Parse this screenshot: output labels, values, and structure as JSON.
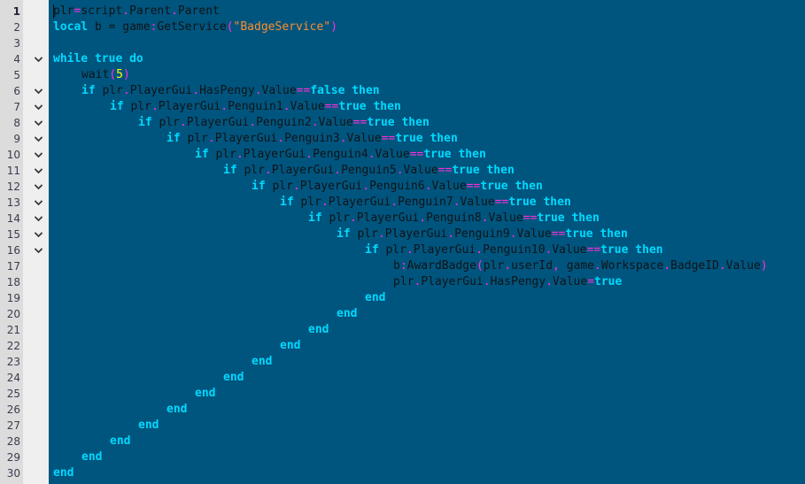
{
  "editor": {
    "title": "Lua Script Editor",
    "language": "Lua",
    "background_color": "#00557e",
    "gutter_number_color": "#3b3b4f",
    "gutter_background": "#dcdcdc",
    "fold_column_background": "#efefef",
    "colors": {
      "keyword": "#00d9ff",
      "operator": "#ff2fd8",
      "number": "#ffff00",
      "string": "#ff8c2b",
      "plain": "#101418"
    },
    "total_lines": 30,
    "line_numbers": [
      "1",
      "2",
      "3",
      "4",
      "5",
      "6",
      "7",
      "8",
      "9",
      "10",
      "11",
      "12",
      "13",
      "14",
      "15",
      "16",
      "17",
      "18",
      "19",
      "20",
      "21",
      "22",
      "23",
      "24",
      "25",
      "26",
      "27",
      "28",
      "29",
      "30"
    ],
    "fold_markers": [
      4,
      6,
      7,
      8,
      9,
      10,
      11,
      12,
      13,
      14,
      15,
      16
    ],
    "fold_icon": "chevron-down-icon",
    "caret_line": 1,
    "caret_column": 0,
    "lines": [
      {
        "n": 1,
        "indent": 0,
        "tokens": [
          {
            "t": "plr",
            "c": "plain"
          },
          {
            "t": "=",
            "c": "op"
          },
          {
            "t": "script",
            "c": "plain"
          },
          {
            "t": ".",
            "c": "op"
          },
          {
            "t": "Parent",
            "c": "plain"
          },
          {
            "t": ".",
            "c": "op"
          },
          {
            "t": "Parent",
            "c": "plain"
          }
        ]
      },
      {
        "n": 2,
        "indent": 0,
        "tokens": [
          {
            "t": "local",
            "c": "kw"
          },
          {
            "t": " b = game",
            "c": "plain"
          },
          {
            "t": ":",
            "c": "op"
          },
          {
            "t": "GetService",
            "c": "plain"
          },
          {
            "t": "(",
            "c": "op"
          },
          {
            "t": "\"BadgeService\"",
            "c": "str"
          },
          {
            "t": ")",
            "c": "op"
          }
        ]
      },
      {
        "n": 3,
        "indent": 0,
        "tokens": []
      },
      {
        "n": 4,
        "indent": 0,
        "tokens": [
          {
            "t": "while true do",
            "c": "kw"
          }
        ]
      },
      {
        "n": 5,
        "indent": 4,
        "tokens": [
          {
            "t": "wait",
            "c": "plain"
          },
          {
            "t": "(",
            "c": "op"
          },
          {
            "t": "5",
            "c": "num"
          },
          {
            "t": ")",
            "c": "op"
          }
        ]
      },
      {
        "n": 6,
        "indent": 4,
        "tokens": [
          {
            "t": "if",
            "c": "kw"
          },
          {
            "t": " plr",
            "c": "plain"
          },
          {
            "t": ".",
            "c": "op"
          },
          {
            "t": "PlayerGui",
            "c": "plain"
          },
          {
            "t": ".",
            "c": "op"
          },
          {
            "t": "HasPengy",
            "c": "plain"
          },
          {
            "t": ".",
            "c": "op"
          },
          {
            "t": "Value",
            "c": "plain"
          },
          {
            "t": "==",
            "c": "op"
          },
          {
            "t": "false then",
            "c": "kw"
          }
        ]
      },
      {
        "n": 7,
        "indent": 8,
        "tokens": [
          {
            "t": "if",
            "c": "kw"
          },
          {
            "t": " plr",
            "c": "plain"
          },
          {
            "t": ".",
            "c": "op"
          },
          {
            "t": "PlayerGui",
            "c": "plain"
          },
          {
            "t": ".",
            "c": "op"
          },
          {
            "t": "Penguin1",
            "c": "plain"
          },
          {
            "t": ".",
            "c": "op"
          },
          {
            "t": "Value",
            "c": "plain"
          },
          {
            "t": "==",
            "c": "op"
          },
          {
            "t": "true then",
            "c": "kw"
          }
        ]
      },
      {
        "n": 8,
        "indent": 12,
        "tokens": [
          {
            "t": "if",
            "c": "kw"
          },
          {
            "t": " plr",
            "c": "plain"
          },
          {
            "t": ".",
            "c": "op"
          },
          {
            "t": "PlayerGui",
            "c": "plain"
          },
          {
            "t": ".",
            "c": "op"
          },
          {
            "t": "Penguin2",
            "c": "plain"
          },
          {
            "t": ".",
            "c": "op"
          },
          {
            "t": "Value",
            "c": "plain"
          },
          {
            "t": "==",
            "c": "op"
          },
          {
            "t": "true then",
            "c": "kw"
          }
        ]
      },
      {
        "n": 9,
        "indent": 16,
        "tokens": [
          {
            "t": "if",
            "c": "kw"
          },
          {
            "t": " plr",
            "c": "plain"
          },
          {
            "t": ".",
            "c": "op"
          },
          {
            "t": "PlayerGui",
            "c": "plain"
          },
          {
            "t": ".",
            "c": "op"
          },
          {
            "t": "Penguin3",
            "c": "plain"
          },
          {
            "t": ".",
            "c": "op"
          },
          {
            "t": "Value",
            "c": "plain"
          },
          {
            "t": "==",
            "c": "op"
          },
          {
            "t": "true then",
            "c": "kw"
          }
        ]
      },
      {
        "n": 10,
        "indent": 20,
        "tokens": [
          {
            "t": "if",
            "c": "kw"
          },
          {
            "t": " plr",
            "c": "plain"
          },
          {
            "t": ".",
            "c": "op"
          },
          {
            "t": "PlayerGui",
            "c": "plain"
          },
          {
            "t": ".",
            "c": "op"
          },
          {
            "t": "Penguin4",
            "c": "plain"
          },
          {
            "t": ".",
            "c": "op"
          },
          {
            "t": "Value",
            "c": "plain"
          },
          {
            "t": "==",
            "c": "op"
          },
          {
            "t": "true then",
            "c": "kw"
          }
        ]
      },
      {
        "n": 11,
        "indent": 24,
        "tokens": [
          {
            "t": "if",
            "c": "kw"
          },
          {
            "t": " plr",
            "c": "plain"
          },
          {
            "t": ".",
            "c": "op"
          },
          {
            "t": "PlayerGui",
            "c": "plain"
          },
          {
            "t": ".",
            "c": "op"
          },
          {
            "t": "Penguin5",
            "c": "plain"
          },
          {
            "t": ".",
            "c": "op"
          },
          {
            "t": "Value",
            "c": "plain"
          },
          {
            "t": "==",
            "c": "op"
          },
          {
            "t": "true then",
            "c": "kw"
          }
        ]
      },
      {
        "n": 12,
        "indent": 28,
        "tokens": [
          {
            "t": "if",
            "c": "kw"
          },
          {
            "t": " plr",
            "c": "plain"
          },
          {
            "t": ".",
            "c": "op"
          },
          {
            "t": "PlayerGui",
            "c": "plain"
          },
          {
            "t": ".",
            "c": "op"
          },
          {
            "t": "Penguin6",
            "c": "plain"
          },
          {
            "t": ".",
            "c": "op"
          },
          {
            "t": "Value",
            "c": "plain"
          },
          {
            "t": "==",
            "c": "op"
          },
          {
            "t": "true then",
            "c": "kw"
          }
        ]
      },
      {
        "n": 13,
        "indent": 32,
        "tokens": [
          {
            "t": "if",
            "c": "kw"
          },
          {
            "t": " plr",
            "c": "plain"
          },
          {
            "t": ".",
            "c": "op"
          },
          {
            "t": "PlayerGui",
            "c": "plain"
          },
          {
            "t": ".",
            "c": "op"
          },
          {
            "t": "Penguin7",
            "c": "plain"
          },
          {
            "t": ".",
            "c": "op"
          },
          {
            "t": "Value",
            "c": "plain"
          },
          {
            "t": "==",
            "c": "op"
          },
          {
            "t": "true then",
            "c": "kw"
          }
        ]
      },
      {
        "n": 14,
        "indent": 36,
        "tokens": [
          {
            "t": "if",
            "c": "kw"
          },
          {
            "t": " plr",
            "c": "plain"
          },
          {
            "t": ".",
            "c": "op"
          },
          {
            "t": "PlayerGui",
            "c": "plain"
          },
          {
            "t": ".",
            "c": "op"
          },
          {
            "t": "Penguin8",
            "c": "plain"
          },
          {
            "t": ".",
            "c": "op"
          },
          {
            "t": "Value",
            "c": "plain"
          },
          {
            "t": "==",
            "c": "op"
          },
          {
            "t": "true then",
            "c": "kw"
          }
        ]
      },
      {
        "n": 15,
        "indent": 40,
        "tokens": [
          {
            "t": "if",
            "c": "kw"
          },
          {
            "t": " plr",
            "c": "plain"
          },
          {
            "t": ".",
            "c": "op"
          },
          {
            "t": "PlayerGui",
            "c": "plain"
          },
          {
            "t": ".",
            "c": "op"
          },
          {
            "t": "Penguin9",
            "c": "plain"
          },
          {
            "t": ".",
            "c": "op"
          },
          {
            "t": "Value",
            "c": "plain"
          },
          {
            "t": "==",
            "c": "op"
          },
          {
            "t": "true then",
            "c": "kw"
          }
        ]
      },
      {
        "n": 16,
        "indent": 44,
        "tokens": [
          {
            "t": "if",
            "c": "kw"
          },
          {
            "t": " plr",
            "c": "plain"
          },
          {
            "t": ".",
            "c": "op"
          },
          {
            "t": "PlayerGui",
            "c": "plain"
          },
          {
            "t": ".",
            "c": "op"
          },
          {
            "t": "Penguin10",
            "c": "plain"
          },
          {
            "t": ".",
            "c": "op"
          },
          {
            "t": "Value",
            "c": "plain"
          },
          {
            "t": "==",
            "c": "op"
          },
          {
            "t": "true then",
            "c": "kw"
          }
        ]
      },
      {
        "n": 17,
        "indent": 48,
        "tokens": [
          {
            "t": "b",
            "c": "plain"
          },
          {
            "t": ":",
            "c": "op"
          },
          {
            "t": "AwardBadge",
            "c": "plain"
          },
          {
            "t": "(",
            "c": "op"
          },
          {
            "t": "plr",
            "c": "plain"
          },
          {
            "t": ".",
            "c": "op"
          },
          {
            "t": "userId",
            "c": "plain"
          },
          {
            "t": ",",
            "c": "op"
          },
          {
            "t": " game",
            "c": "plain"
          },
          {
            "t": ".",
            "c": "op"
          },
          {
            "t": "Workspace",
            "c": "plain"
          },
          {
            "t": ".",
            "c": "op"
          },
          {
            "t": "BadgeID",
            "c": "plain"
          },
          {
            "t": ".",
            "c": "op"
          },
          {
            "t": "Value",
            "c": "plain"
          },
          {
            "t": ")",
            "c": "op"
          }
        ]
      },
      {
        "n": 18,
        "indent": 48,
        "tokens": [
          {
            "t": "plr",
            "c": "plain"
          },
          {
            "t": ".",
            "c": "op"
          },
          {
            "t": "PlayerGui",
            "c": "plain"
          },
          {
            "t": ".",
            "c": "op"
          },
          {
            "t": "HasPengy",
            "c": "plain"
          },
          {
            "t": ".",
            "c": "op"
          },
          {
            "t": "Value",
            "c": "plain"
          },
          {
            "t": "=",
            "c": "op"
          },
          {
            "t": "true",
            "c": "kw"
          }
        ]
      },
      {
        "n": 19,
        "indent": 44,
        "tokens": [
          {
            "t": "end",
            "c": "kw"
          }
        ]
      },
      {
        "n": 20,
        "indent": 40,
        "tokens": [
          {
            "t": "end",
            "c": "kw"
          }
        ]
      },
      {
        "n": 21,
        "indent": 36,
        "tokens": [
          {
            "t": "end",
            "c": "kw"
          }
        ]
      },
      {
        "n": 22,
        "indent": 32,
        "tokens": [
          {
            "t": "end",
            "c": "kw"
          }
        ]
      },
      {
        "n": 23,
        "indent": 28,
        "tokens": [
          {
            "t": "end",
            "c": "kw"
          }
        ]
      },
      {
        "n": 24,
        "indent": 24,
        "tokens": [
          {
            "t": "end",
            "c": "kw"
          }
        ]
      },
      {
        "n": 25,
        "indent": 20,
        "tokens": [
          {
            "t": "end",
            "c": "kw"
          }
        ]
      },
      {
        "n": 26,
        "indent": 16,
        "tokens": [
          {
            "t": "end",
            "c": "kw"
          }
        ]
      },
      {
        "n": 27,
        "indent": 12,
        "tokens": [
          {
            "t": "end",
            "c": "kw"
          }
        ]
      },
      {
        "n": 28,
        "indent": 8,
        "tokens": [
          {
            "t": "end",
            "c": "kw"
          }
        ]
      },
      {
        "n": 29,
        "indent": 4,
        "tokens": [
          {
            "t": "end",
            "c": "kw"
          }
        ]
      },
      {
        "n": 30,
        "indent": 0,
        "tokens": [
          {
            "t": "end",
            "c": "kw"
          }
        ]
      }
    ]
  }
}
